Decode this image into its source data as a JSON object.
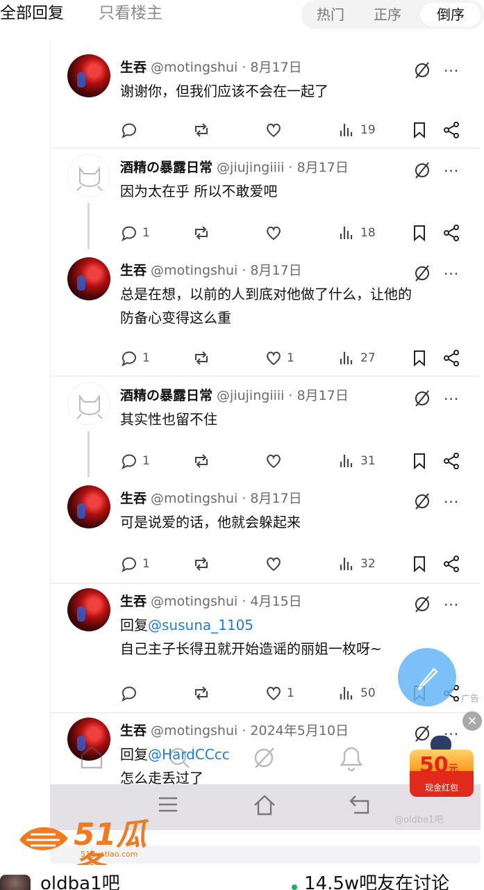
{
  "filter_bar": {
    "all_replies": "全部回复",
    "op_only": "只看楼主",
    "sort_hot": "热门",
    "sort_asc": "正序",
    "sort_desc": "倒序"
  },
  "tweets": [
    {
      "name": "生吞",
      "handle": "@motingshui",
      "date": "· 8月17日",
      "avatar": "red",
      "lines": [
        "谢谢你，但我们应该不会在一起了"
      ],
      "replies": "",
      "likes": "",
      "views": "19"
    },
    {
      "name": "酒精の暴露日常",
      "handle": "@jiujingiiii",
      "date": "· 8月17日",
      "avatar": "cat",
      "lines": [
        "因为太在乎 所以不敢爱吧"
      ],
      "replies": "1",
      "likes": "",
      "views": "18"
    },
    {
      "name": "生吞",
      "handle": "@motingshui",
      "date": "· 8月17日",
      "avatar": "red",
      "lines": [
        "总是在想，以前的人到底对他做了什么，让他的",
        "防备心变得这么重"
      ],
      "replies": "1",
      "likes": "1",
      "views": "27"
    },
    {
      "name": "酒精の暴露日常",
      "handle": "@jiujingiiii",
      "date": "· 8月17日",
      "avatar": "cat",
      "lines": [
        "其实性也留不住"
      ],
      "replies": "1",
      "likes": "",
      "views": "31"
    },
    {
      "name": "生吞",
      "handle": "@motingshui",
      "date": "· 8月17日",
      "avatar": "red",
      "lines": [
        "可是说爱的话，他就会躲起来"
      ],
      "replies": "1",
      "likes": "",
      "views": "32"
    },
    {
      "name": "生吞",
      "handle": "@motingshui",
      "date": "· 4月15日",
      "avatar": "red",
      "reply_to_label": "回复",
      "reply_to": "@susuna_1105",
      "lines": [
        "自己主子长得丑就开始造谣的丽姐一枚呀~"
      ],
      "replies": "",
      "likes": "1",
      "views": "50"
    },
    {
      "name": "生吞",
      "handle": "@motingshui",
      "date": "· 2024年5月10日",
      "avatar": "red",
      "reply_to_label": "回复",
      "reply_to": "@HardCCcc",
      "lines": [
        "怎么走丢过了"
      ],
      "replies": "",
      "likes": "",
      "views": ""
    }
  ],
  "ad": {
    "label": "广告",
    "close": "×",
    "amount": "50",
    "unit": "元",
    "caption": "现金红包"
  },
  "watermark": {
    "logo": "51瓜条",
    "url": "51guatiao.com",
    "tieba": "@oldba1吧"
  },
  "bottom_bar": {
    "forum_name": "oldba1吧",
    "status": "14.5w吧友在讨论"
  },
  "colors": {
    "accent_blue": "#1d7ee3",
    "watermark_orange": "#f07a1e",
    "online_green": "#19b35a"
  }
}
